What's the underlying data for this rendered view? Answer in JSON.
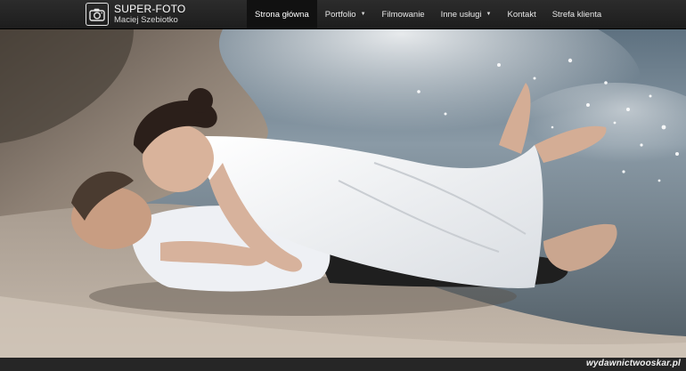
{
  "brand": {
    "title": "SUPER-FOTO",
    "subtitle": "Maciej Szebiotko",
    "icon": "camera-icon"
  },
  "nav": {
    "items": [
      {
        "label": "Strona główna",
        "active": true,
        "dropdown": false
      },
      {
        "label": "Portfolio",
        "active": false,
        "dropdown": true
      },
      {
        "label": "Filmowanie",
        "active": false,
        "dropdown": false
      },
      {
        "label": "Inne usługi",
        "active": false,
        "dropdown": true
      },
      {
        "label": "Kontakt",
        "active": false,
        "dropdown": false
      },
      {
        "label": "Strefa klienta",
        "active": false,
        "dropdown": false
      }
    ],
    "caret_glyph": "▼"
  },
  "hero": {
    "description_hidden": false
  },
  "watermark": "wydawnictwooskar.pl",
  "colors": {
    "navbar": "#242424",
    "active_item": "#111111",
    "text": "#e8e8e8"
  }
}
